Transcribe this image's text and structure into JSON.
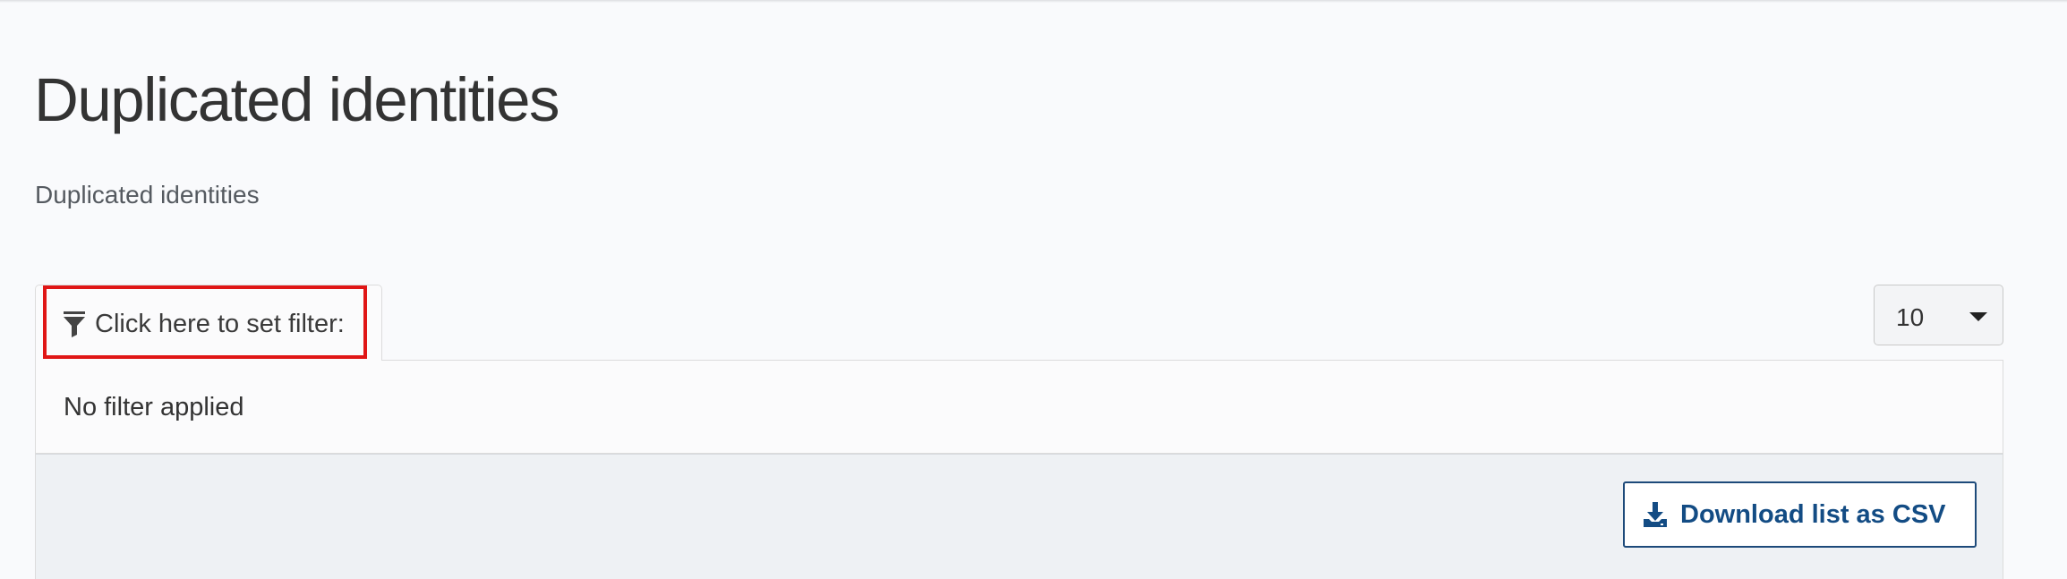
{
  "page": {
    "title": "Duplicated identities",
    "subtitle": "Duplicated identities"
  },
  "filter": {
    "toggle_label": "Click here to set filter:",
    "toggle_icon": "filter-icon",
    "status_text": "No filter applied"
  },
  "page_size": {
    "selected": "10",
    "icon": "caret-down-icon"
  },
  "toolbar": {
    "download_label": "Download list as CSV",
    "download_icon": "download-icon"
  },
  "colors": {
    "background": "#f9fafc",
    "highlight": "#e01616",
    "button_text": "#134c84",
    "button_border": "#1d4a7a",
    "toolbar_background": "#eef1f4"
  }
}
